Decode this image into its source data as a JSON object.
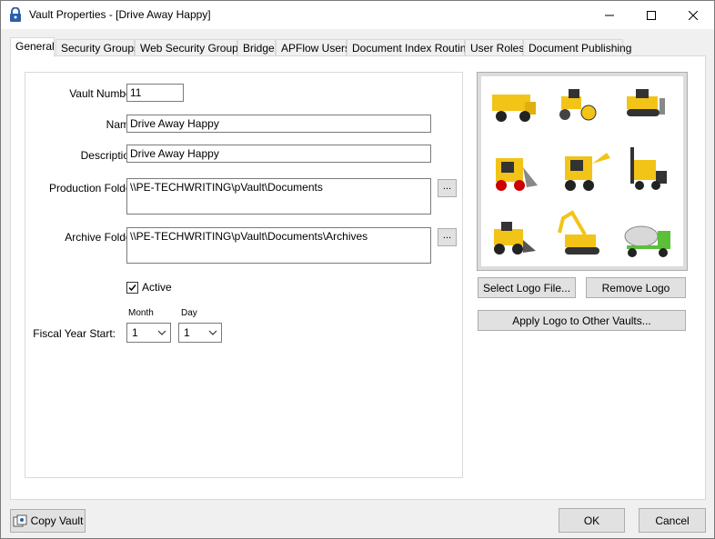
{
  "window": {
    "title": "Vault Properties - [Drive Away Happy]"
  },
  "tabs": [
    {
      "label": "General"
    },
    {
      "label": "Security Groups"
    },
    {
      "label": "Web Security Groups"
    },
    {
      "label": "Bridge"
    },
    {
      "label": "APFlow Users"
    },
    {
      "label": "Document Index Routing"
    },
    {
      "label": "User Roles"
    },
    {
      "label": "Document Publishing"
    }
  ],
  "general": {
    "vault_number": {
      "label": "Vault Number:",
      "value": "11"
    },
    "name": {
      "label": "Name:",
      "value": "Drive Away Happy"
    },
    "description": {
      "label": "Description:",
      "value": "Drive Away Happy"
    },
    "production_folder": {
      "label": "Production Folder:",
      "value": "\\\\PE-TECHWRITING\\pVault\\Documents",
      "browse": "..."
    },
    "archive_folder": {
      "label": "Archive Folder:",
      "value": "\\\\PE-TECHWRITING\\pVault\\Documents\\Archives",
      "browse": "..."
    },
    "active": {
      "label": "Active",
      "checked": true
    },
    "fiscal_year_start": {
      "label": "Fiscal Year Start:",
      "month_label": "Month",
      "day_label": "Day",
      "month_value": "1",
      "day_value": "1"
    }
  },
  "logo": {
    "select_label": "Select Logo File...",
    "remove_label": "Remove Logo",
    "apply_label": "Apply Logo to Other Vaults..."
  },
  "footer": {
    "copy_vault_label": "Copy Vault",
    "ok_label": "OK",
    "cancel_label": "Cancel"
  },
  "colors": {
    "machine_yellow": "#f2c417",
    "accent_blue": "#0078d7",
    "mixer_green": "#5bbf3a"
  }
}
